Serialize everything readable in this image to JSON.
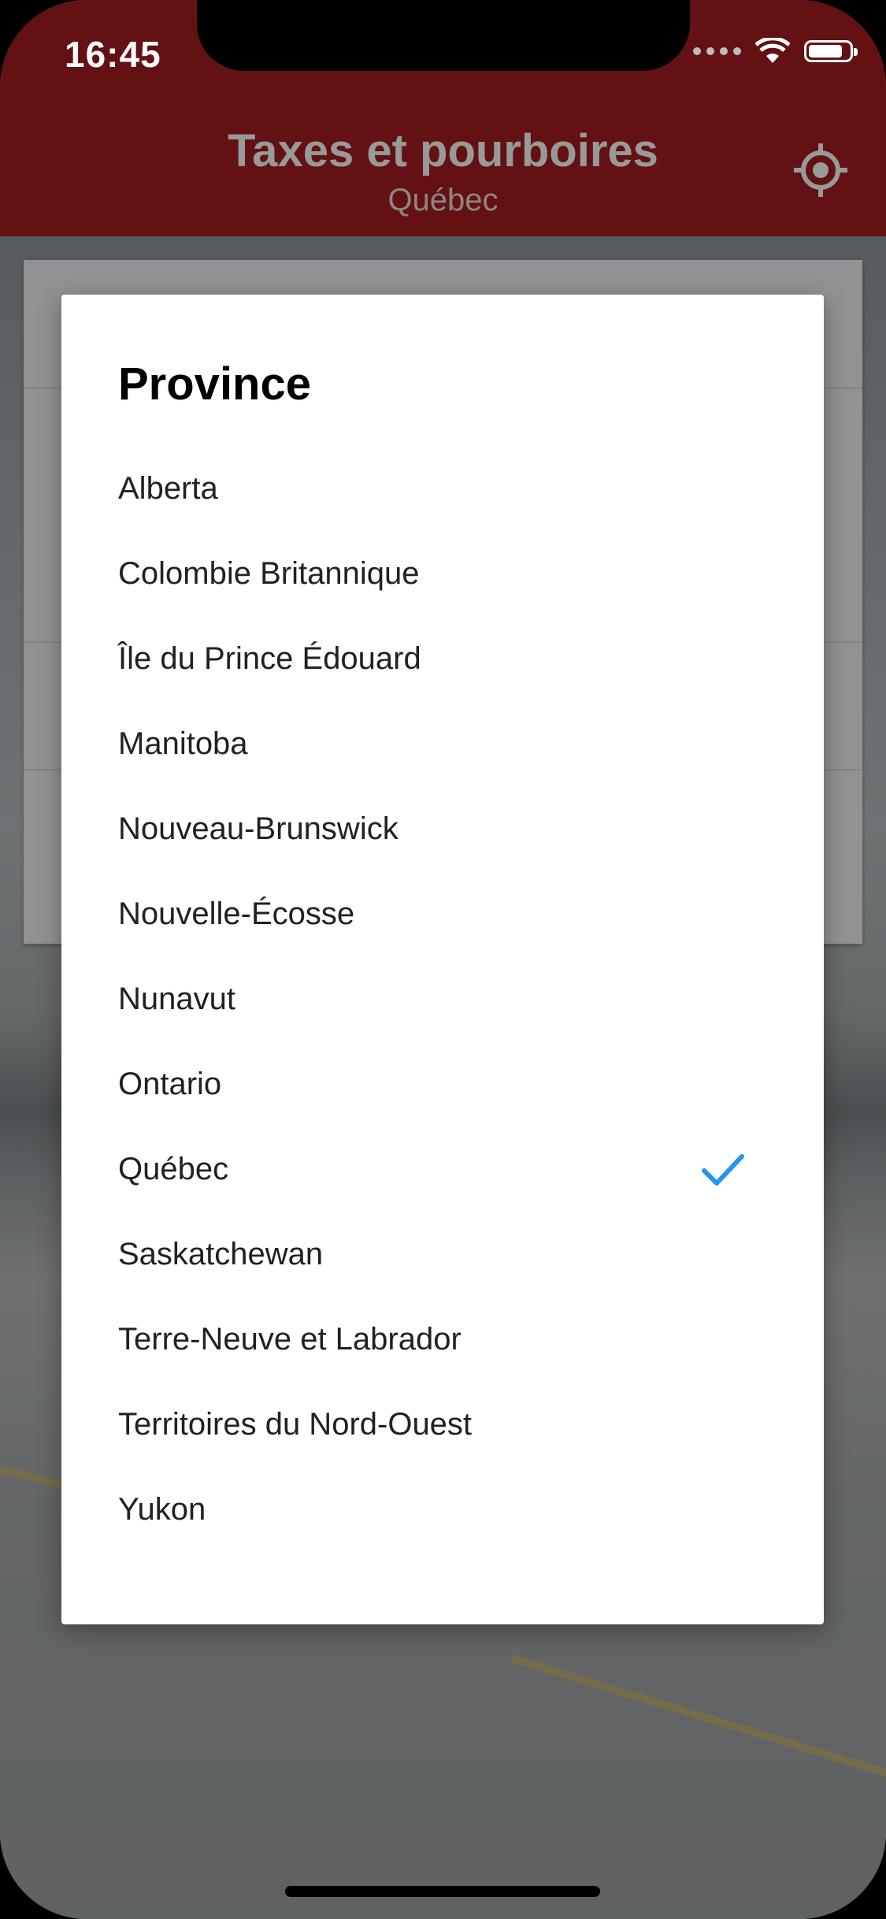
{
  "status_bar": {
    "time": "16:45"
  },
  "header": {
    "title": "Taxes et pourboires",
    "subtitle": "Québec",
    "locate_icon": "crosshair-icon"
  },
  "dialog": {
    "title": "Province",
    "selected": "Québec",
    "options": [
      {
        "label": "Alberta"
      },
      {
        "label": "Colombie Britannique"
      },
      {
        "label": "Île du Prince Édouard"
      },
      {
        "label": "Manitoba"
      },
      {
        "label": "Nouveau-Brunswick"
      },
      {
        "label": "Nouvelle-Écosse"
      },
      {
        "label": "Nunavut"
      },
      {
        "label": "Ontario"
      },
      {
        "label": "Québec"
      },
      {
        "label": "Saskatchewan"
      },
      {
        "label": "Terre-Neuve et Labrador"
      },
      {
        "label": "Territoires du Nord-Ouest"
      },
      {
        "label": "Yukon"
      }
    ]
  },
  "colors": {
    "header": "#a61d1f",
    "accent": "#2196f3",
    "dialog_background": "#ffffff"
  }
}
